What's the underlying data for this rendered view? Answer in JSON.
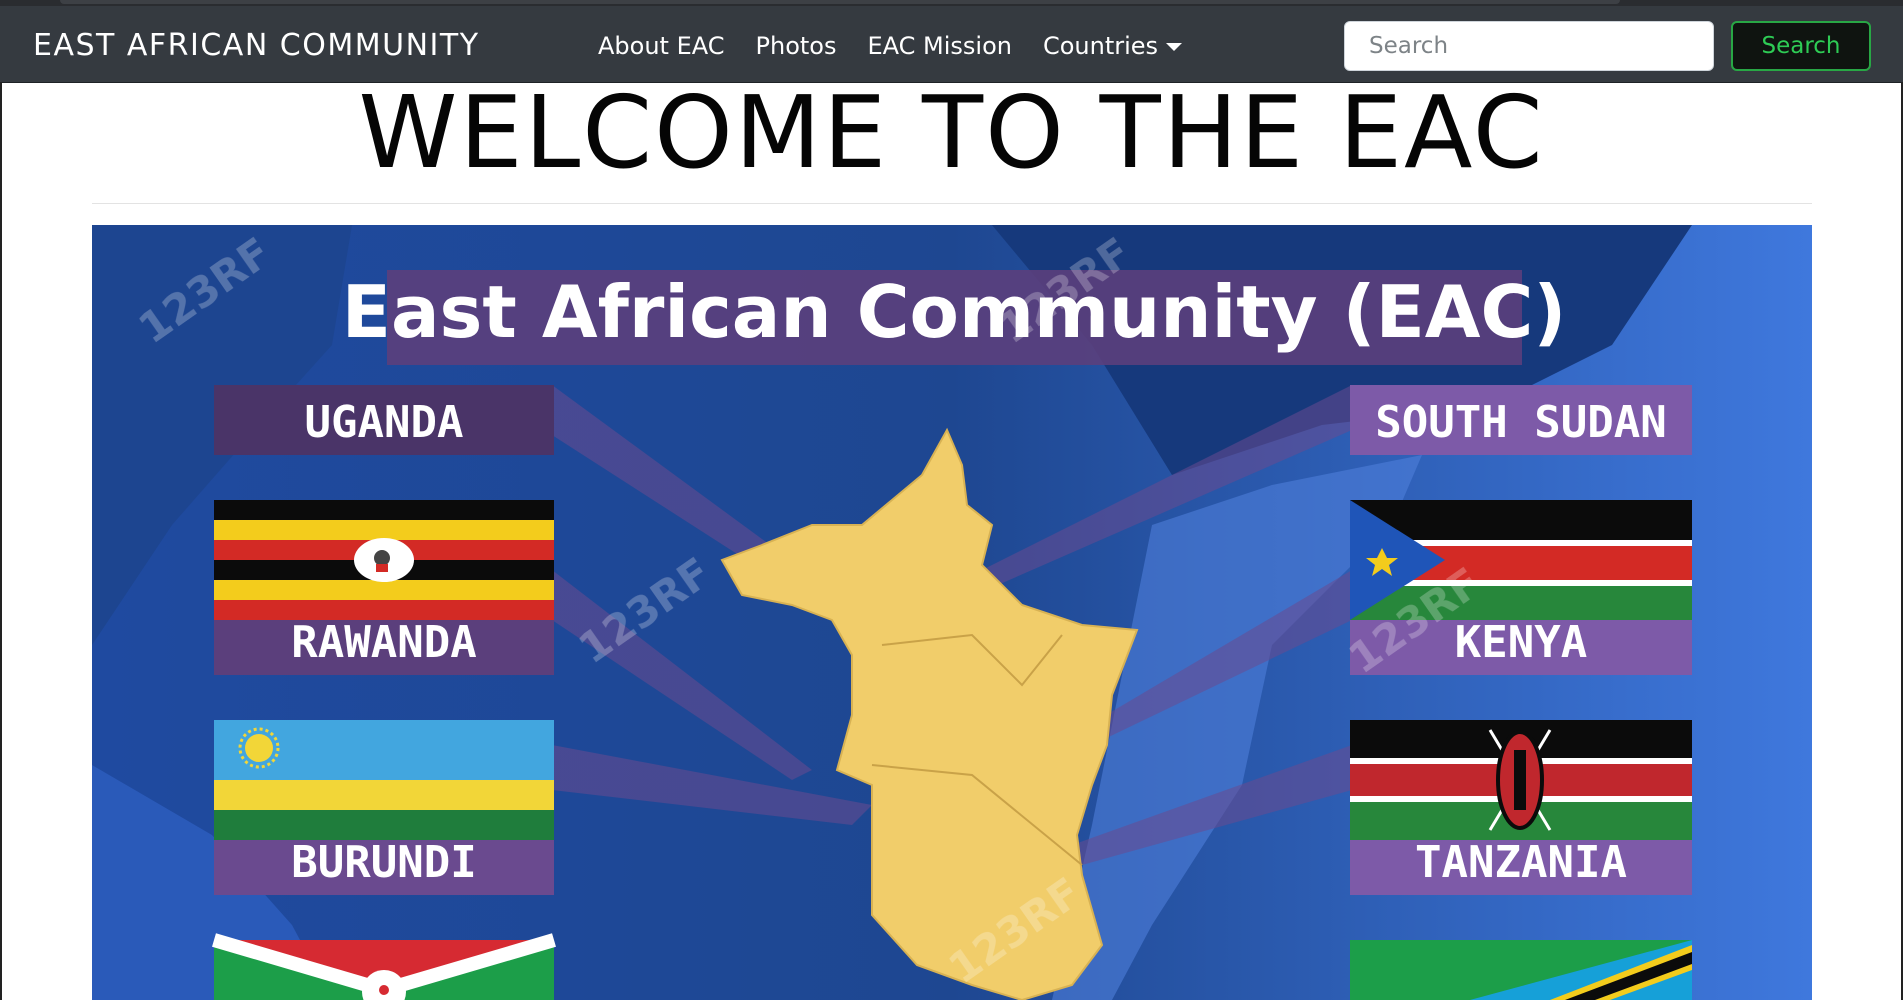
{
  "navbar": {
    "brand": "EAST AFRICAN COMMUNITY",
    "links": [
      "About EAC",
      "Photos",
      "EAC Mission"
    ],
    "dropdown_label": "Countries",
    "search_placeholder": "Search",
    "search_button": "Search"
  },
  "main": {
    "heading": "WELCOME TO THE EAC"
  },
  "banner": {
    "title": "East African Community (EAC)",
    "watermark": "123RF",
    "countries_left": [
      "UGANDA",
      "RAWANDA",
      "BURUNDI"
    ],
    "countries_right": [
      "SOUTH SUDAN",
      "KENYA",
      "TANZANIA"
    ]
  },
  "colors": {
    "navbar_bg": "#353a40",
    "search_button_border": "#28a745",
    "search_button_text": "#2ecc55",
    "banner_sea": "#3563c4",
    "label_bg": "#5b3f7c",
    "map_land": "#f1cd6a"
  }
}
